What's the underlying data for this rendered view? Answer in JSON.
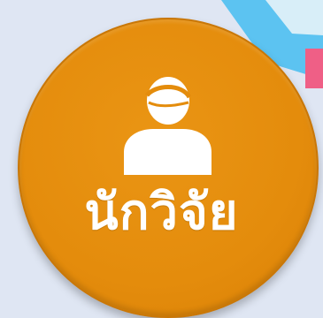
{
  "button": {
    "label": "นักวิจัย",
    "icon": "user-icon",
    "color": "#e48c0c"
  },
  "colors": {
    "background": "#dfe6f3",
    "decor_panel": "#5cc3f1",
    "decor_tab": "#ef5f86"
  }
}
